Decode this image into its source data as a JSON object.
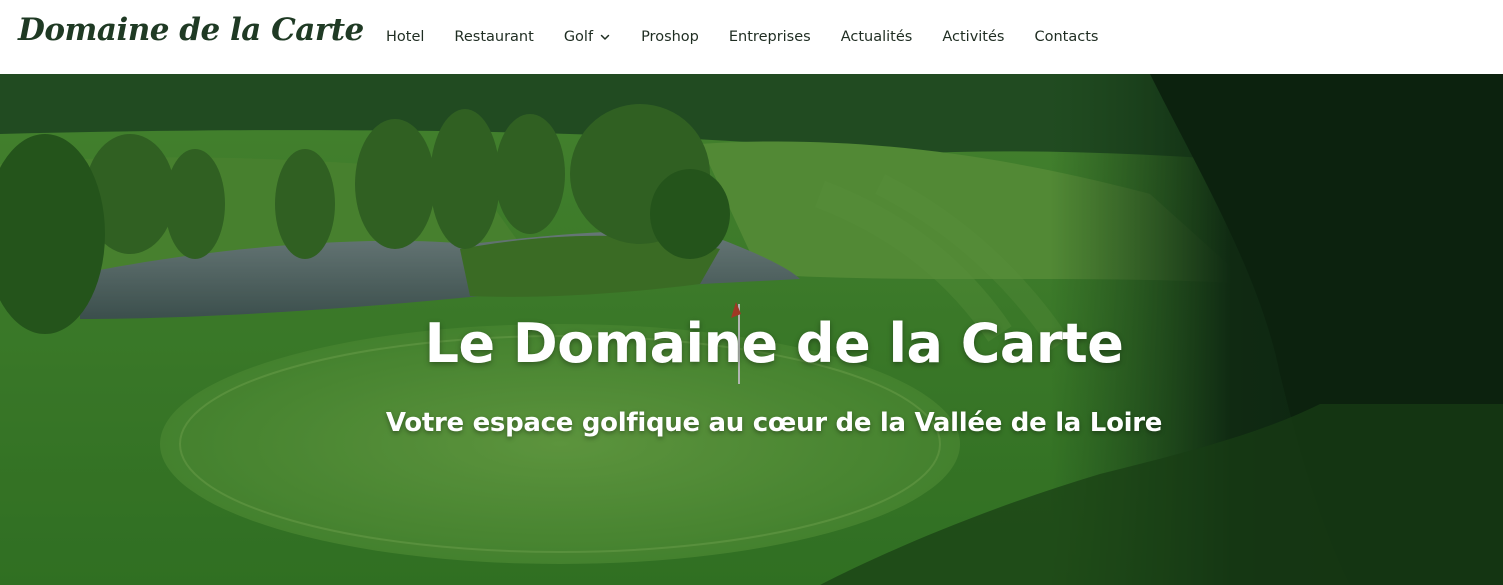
{
  "site": {
    "logo": "Domaine de la Carte"
  },
  "nav": {
    "items": [
      {
        "label": "Hotel"
      },
      {
        "label": "Restaurant"
      },
      {
        "label": "Golf",
        "has_dropdown": true
      },
      {
        "label": "Proshop"
      },
      {
        "label": "Entreprises"
      },
      {
        "label": "Actualités"
      },
      {
        "label": "Activités"
      },
      {
        "label": "Contacts"
      }
    ]
  },
  "hero": {
    "title": "Le Domaine de la Carte",
    "subtitle": "Votre espace golfique au cœur de la Vallée de la Loire"
  },
  "colors": {
    "logo": "#1f3a24",
    "nav_text": "#1f2d22",
    "fairway": "#4a9a34",
    "dark_forest": "#0f2a14",
    "hero_text": "#ffffff"
  }
}
